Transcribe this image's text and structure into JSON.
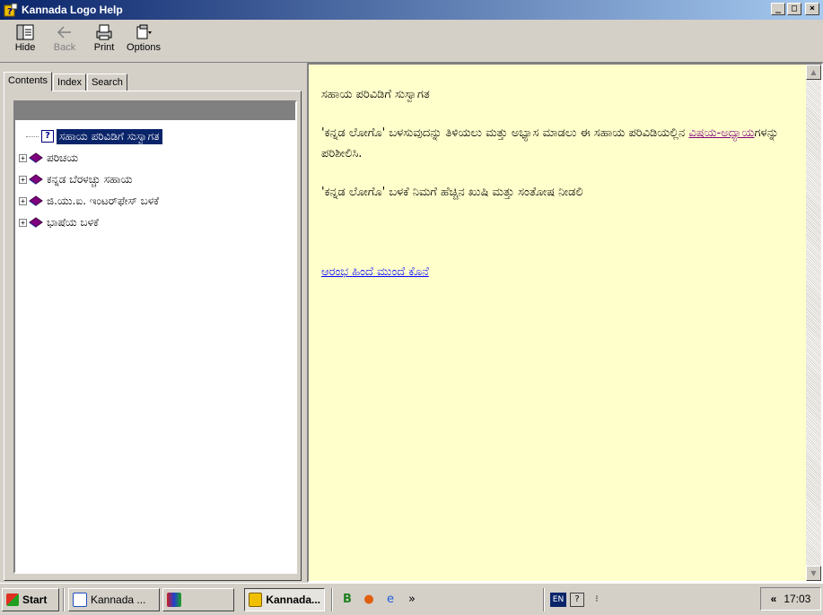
{
  "window": {
    "title": "Kannada Logo Help",
    "buttons": {
      "minimize": "_",
      "maximize": "□",
      "close": "×"
    }
  },
  "toolbar": {
    "hide": "Hide",
    "back": "Back",
    "print": "Print",
    "options": "Options"
  },
  "tabs": {
    "contents": "Contents",
    "index": "Index",
    "search": "Search"
  },
  "tree": {
    "items": [
      {
        "label": "ಸಹಾಯ ಪರಿವಿಡಿಗೆ ಸುಸ್ವಾಗತ",
        "icon": "help-page-icon",
        "selected": true
      },
      {
        "label": "ಪರಿಚಯ",
        "icon": "book-icon"
      },
      {
        "label": "ಕನ್ನಡ ಬೆರಳಚ್ಚು ಸಹಾಯ",
        "icon": "book-icon"
      },
      {
        "label": "ಜಿ.ಯು.ಐ. ಇಂಟರ್‌ಫೇಸ್ ಬಳಕೆ",
        "icon": "book-icon"
      },
      {
        "label": "ಭಾಷೆಯ ಬಳಕೆ",
        "icon": "book-icon"
      }
    ]
  },
  "content": {
    "heading": "ಸಹಾಯ ಪರಿವಿಡಿಗೆ ಸುಸ್ವಾಗತ",
    "para1_a": "'ಕನ್ನಡ ಲೋಗೊ' ಬಳಸುವುದನ್ನು ತಿಳಿಯಲು ಮತ್ತು ಅಭ್ಯಾಸ ಮಾಡಲು ಈ ಸಹಾಯ ಪರಿವಿಡಿಯಲ್ಲಿನ ",
    "para1_link": "ವಿಷಯ-ಅಧ್ಯಾಯ",
    "para1_b": "ಗಳನ್ನು ಪರಿಶೀಲಿಸಿ.",
    "para2": "'ಕನ್ನಡ ಲೋಗೊ' ಬಳಕೆ ನಿಮಗೆ ಹೆಚ್ಚಿನ ಖುಷಿ ಮತ್ತು ಸಂತೋಷ ನೀಡಲಿ",
    "nav": [
      "ಆರಂಭ",
      "ಹಿಂದೆ",
      "ಮುಂದೆ",
      "ಕೊನೆ"
    ]
  },
  "taskbar": {
    "start": "Start",
    "task1": "Kannada ...",
    "task2": "Kannada...",
    "chevron": "»",
    "lang": "EN",
    "clock": "17:03",
    "tray_chevron": "«"
  }
}
